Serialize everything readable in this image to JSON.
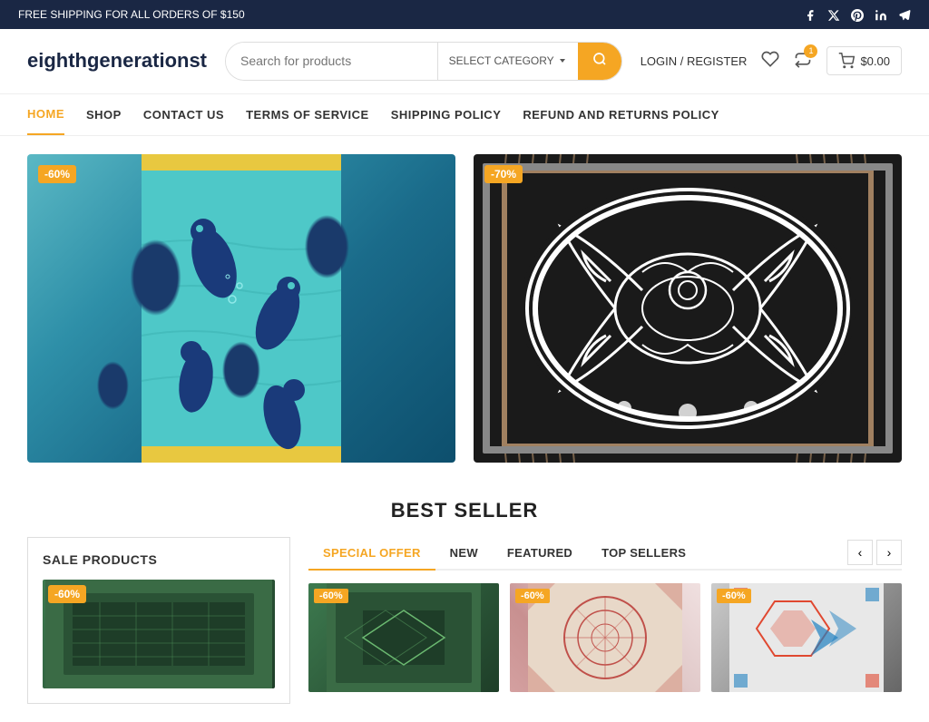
{
  "topbar": {
    "shipping_notice": "FREE SHIPPING FOR ALL ORDERS OF $150",
    "social_icons": [
      "facebook",
      "x-twitter",
      "pinterest",
      "linkedin",
      "telegram"
    ]
  },
  "header": {
    "logo": "eighthgenerationst",
    "search_placeholder": "Search for products",
    "category_label": "SELECT CATEGORY",
    "login_label": "LOGIN / REGISTER",
    "cart_price": "$0.00",
    "wishlist_count": "0",
    "compare_count": "1"
  },
  "nav": {
    "items": [
      {
        "label": "HOME",
        "active": true
      },
      {
        "label": "SHOP",
        "active": false
      },
      {
        "label": "CONTACT US",
        "active": false
      },
      {
        "label": "TERMS OF SERVICE",
        "active": false
      },
      {
        "label": "SHIPPING POLICY",
        "active": false
      },
      {
        "label": "REFUND AND RETURNS POLICY",
        "active": false
      }
    ]
  },
  "hero": {
    "products": [
      {
        "discount": "-60%",
        "alt": "Sea otters teal print"
      },
      {
        "discount": "-70%",
        "alt": "Black white woven blanket"
      }
    ]
  },
  "best_seller": {
    "title": "BEST SELLER"
  },
  "sale_panel": {
    "title": "SALE PRODUCTS",
    "badge": "-60%"
  },
  "offers": {
    "tabs": [
      {
        "label": "SPECIAL OFFER",
        "active": true
      },
      {
        "label": "NEW",
        "active": false
      },
      {
        "label": "FEATURED",
        "active": false
      },
      {
        "label": "TOP SELLERS",
        "active": false
      }
    ],
    "products": [
      {
        "badge": "-60%"
      },
      {
        "badge": "-60%"
      },
      {
        "badge": "-60%"
      }
    ],
    "prev_label": "‹",
    "next_label": "›"
  }
}
